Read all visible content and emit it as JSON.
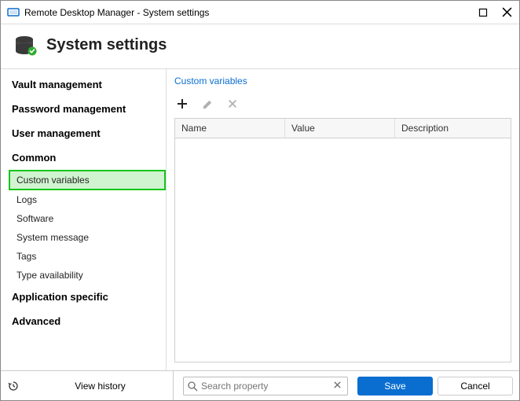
{
  "window": {
    "title": "Remote Desktop Manager - System settings"
  },
  "header": {
    "title": "System settings"
  },
  "sidebar": {
    "sections": {
      "vault": "Vault management",
      "password": "Password management",
      "user": "User management",
      "common": "Common",
      "common_items": {
        "custom_variables": "Custom variables",
        "logs": "Logs",
        "software": "Software",
        "system_message": "System message",
        "tags": "Tags",
        "type_availability": "Type availability"
      },
      "app_specific": "Application specific",
      "advanced": "Advanced"
    }
  },
  "main": {
    "breadcrumb": "Custom variables",
    "table": {
      "columns": {
        "name": "Name",
        "value": "Value",
        "description": "Description"
      },
      "rows": []
    }
  },
  "bottom": {
    "view_history": "View history",
    "search_placeholder": "Search property",
    "save": "Save",
    "cancel": "Cancel"
  }
}
